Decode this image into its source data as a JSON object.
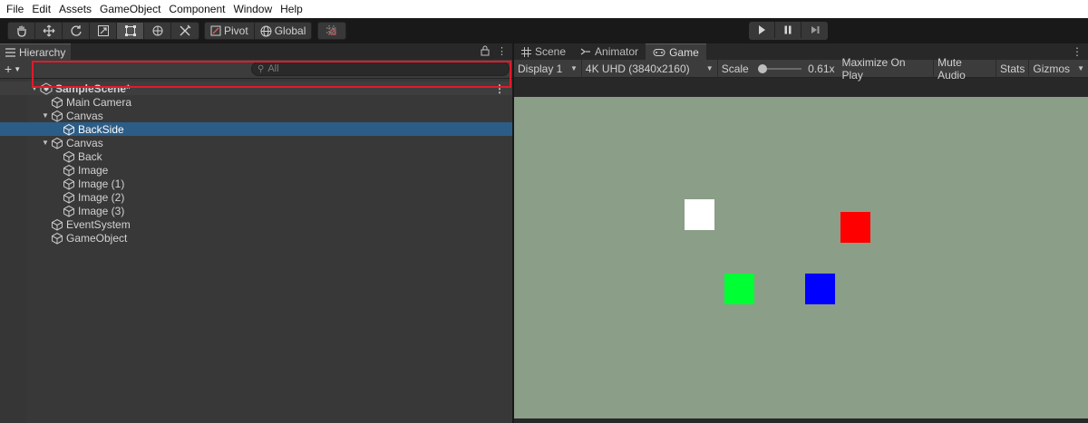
{
  "menu": [
    "File",
    "Edit",
    "Assets",
    "GameObject",
    "Component",
    "Window",
    "Help"
  ],
  "toolbar": {
    "pivot_label": "Pivot",
    "global_label": "Global"
  },
  "hierarchy": {
    "tab_label": "Hierarchy",
    "search_placeholder": "All",
    "rows": [
      {
        "label": "SampleScene*"
      },
      {
        "label": "Main Camera"
      },
      {
        "label": "Canvas"
      },
      {
        "label": "BackSide"
      },
      {
        "label": "Canvas"
      },
      {
        "label": "Back"
      },
      {
        "label": "Image"
      },
      {
        "label": "Image (1)"
      },
      {
        "label": "Image (2)"
      },
      {
        "label": "Image (3)"
      },
      {
        "label": "EventSystem"
      },
      {
        "label": "GameObject"
      }
    ],
    "selected_row": "BackSide"
  },
  "game_panel": {
    "tabs": [
      "Scene",
      "Animator",
      "Game"
    ],
    "active_tab": "Game",
    "display": "Display 1",
    "resolution": "4K UHD (3840x2160)",
    "scale_label": "Scale",
    "scale_value": "0.61x",
    "maximize_on_play": "Maximize On Play",
    "mute_audio": "Mute Audio",
    "stats": "Stats",
    "gizmos": "Gizmos"
  },
  "game_view": {
    "background_color": "#8b9e88",
    "squares": [
      {
        "name": "white-square",
        "color": "#ffffff"
      },
      {
        "name": "red-square",
        "color": "#ff0000"
      },
      {
        "name": "green-square",
        "color": "#00ff33"
      },
      {
        "name": "blue-square",
        "color": "#0000ff"
      }
    ]
  },
  "colors": {
    "selection": "#2c5d87",
    "highlight_border": "#e11a2a"
  }
}
